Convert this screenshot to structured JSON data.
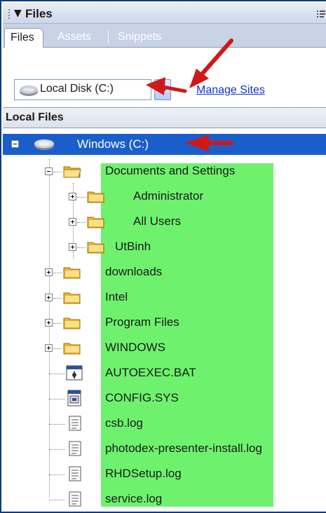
{
  "panel": {
    "title": "Files"
  },
  "tabs": [
    {
      "label": "Files"
    },
    {
      "label": "Assets"
    },
    {
      "label": "Snippets"
    }
  ],
  "toolbar": {
    "site_select_value": "Local Disk (C:)",
    "manage_sites_label": "Manage Sites"
  },
  "local_files": {
    "header": "Local Files"
  },
  "tree": {
    "root": {
      "label": "Windows (C:)",
      "icon": "drive-icon"
    },
    "items": [
      {
        "label": "Documents and Settings",
        "type": "folder",
        "state": "expanded"
      },
      {
        "label": "Administrator",
        "type": "folder",
        "state": "collapsed"
      },
      {
        "label": "All Users",
        "type": "folder",
        "state": "collapsed"
      },
      {
        "label": "UtBinh",
        "type": "folder",
        "state": "collapsed"
      },
      {
        "label": "downloads",
        "type": "folder",
        "state": "collapsed"
      },
      {
        "label": "Intel",
        "type": "folder",
        "state": "collapsed"
      },
      {
        "label": "Program Files",
        "type": "folder",
        "state": "collapsed"
      },
      {
        "label": "WINDOWS",
        "type": "folder",
        "state": "collapsed"
      },
      {
        "label": "AUTOEXEC.BAT",
        "type": "file",
        "icon": "batch-file-icon"
      },
      {
        "label": "CONFIG.SYS",
        "type": "file",
        "icon": "system-file-icon"
      },
      {
        "label": "csb.log",
        "type": "file",
        "icon": "log-file-icon"
      },
      {
        "label": "photodex-presenter-install.log",
        "type": "file",
        "icon": "log-file-icon"
      },
      {
        "label": "RHDSetup.log",
        "type": "file",
        "icon": "log-file-icon"
      },
      {
        "label": "service.log",
        "type": "file",
        "icon": "log-file-icon"
      }
    ]
  },
  "colors": {
    "selection": "#1a5ecb",
    "highlight": "#6ef26e",
    "annotation_arrow": "#d01818",
    "link": "#1033c8"
  }
}
